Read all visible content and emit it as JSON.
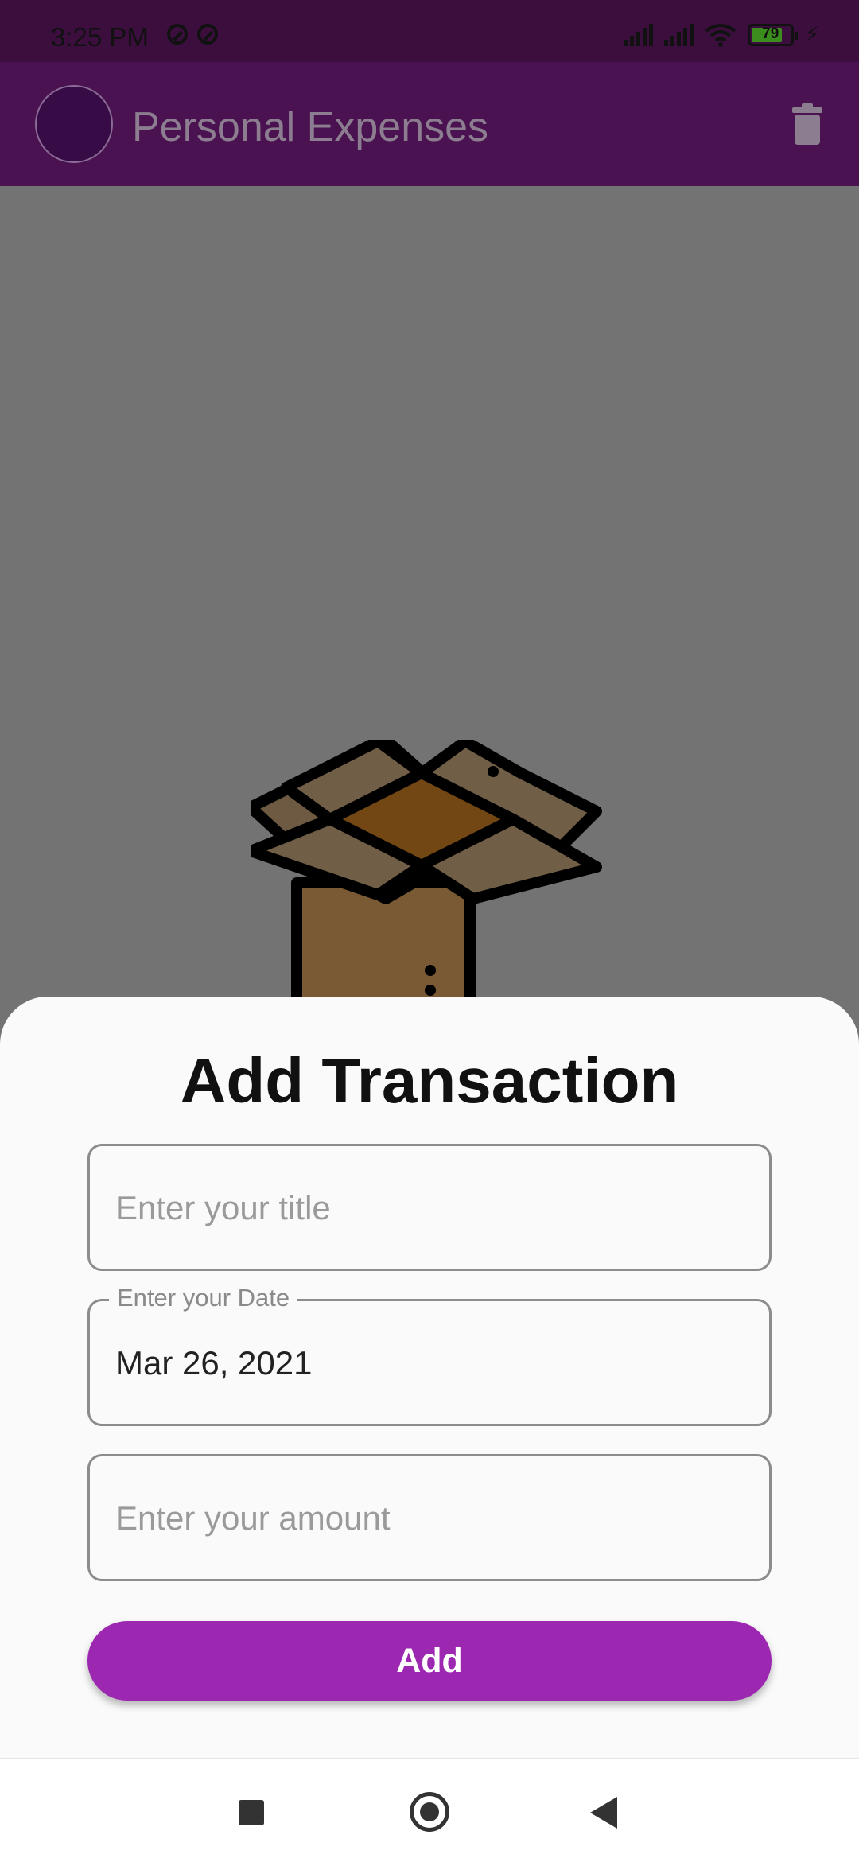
{
  "status_bar": {
    "time": "3:25 PM",
    "battery_level": "79",
    "battery_fraction": 0.79,
    "icons": [
      "do-not-disturb-icon",
      "do-not-disturb-icon",
      "cell-signal-icon",
      "cell-signal-icon",
      "wifi-icon",
      "battery-icon",
      "charging-bolt-icon"
    ]
  },
  "app_bar": {
    "title": "Personal Expenses",
    "actions": [
      "trash-icon"
    ]
  },
  "main": {
    "empty_state_icon": "open-box-icon"
  },
  "sheet": {
    "title": "Add Transaction",
    "title_field": {
      "placeholder": "Enter your title",
      "value": ""
    },
    "date_field": {
      "label": "Enter your Date",
      "value": "Mar 26, 2021"
    },
    "amount_field": {
      "placeholder": "Enter your amount",
      "value": ""
    },
    "add_button_label": "Add"
  },
  "colors": {
    "app_bar": "#4a1250",
    "status_bar": "#3b0e3e",
    "accent": "#9c27b0",
    "scrim": "#737373"
  },
  "nav_bar": {
    "icons": [
      "recents-square-icon",
      "home-circle-icon",
      "back-triangle-icon"
    ]
  }
}
